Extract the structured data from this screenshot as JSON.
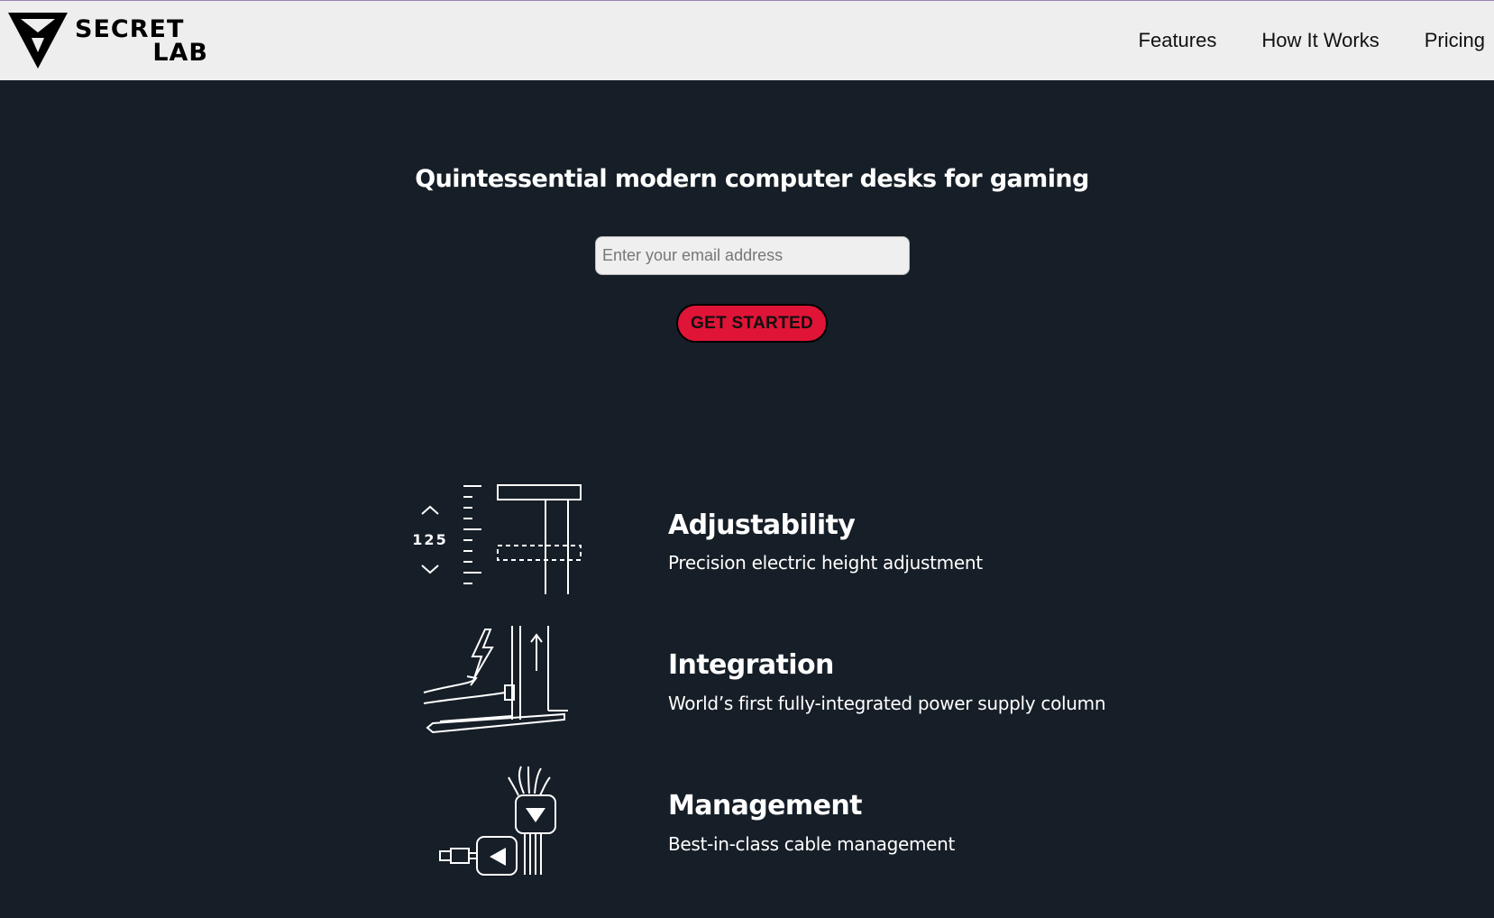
{
  "brand": {
    "logo_line1": "SECRET",
    "logo_line2": "LAB"
  },
  "nav": {
    "items": [
      {
        "label": "Features"
      },
      {
        "label": "How It Works"
      },
      {
        "label": "Pricing"
      }
    ]
  },
  "hero": {
    "title": "Quintessential modern computer desks for gaming",
    "email_placeholder": "Enter your email address",
    "cta_label": "GET STARTED"
  },
  "features": [
    {
      "icon": "height-adjust-icon",
      "height_readout": "125",
      "title": "Adjustability",
      "description": "Precision electric height adjustment"
    },
    {
      "icon": "power-column-icon",
      "title": "Integration",
      "description": "World’s first fully-integrated power supply column"
    },
    {
      "icon": "cable-management-icon",
      "title": "Management",
      "description": "Best-in-class cable management"
    }
  ],
  "colors": {
    "background": "#161e27",
    "header_bg": "#eeeeee",
    "accent": "#e01437",
    "text_light": "#ffffff"
  }
}
